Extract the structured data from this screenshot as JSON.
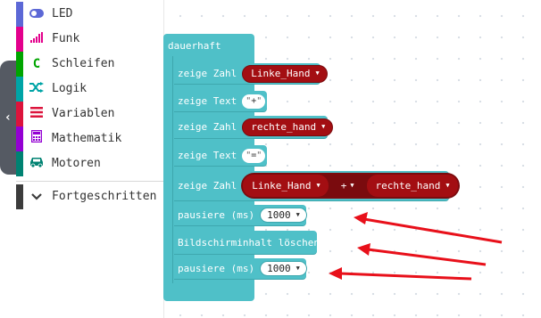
{
  "toolbox": {
    "categories": [
      {
        "label": "LED",
        "color": "#5c68d6",
        "icon": "toggle-icon"
      },
      {
        "label": "Funk",
        "color": "#e3008c",
        "icon": "signal-bars-icon"
      },
      {
        "label": "Schleifen",
        "color": "#00a500",
        "icon": "refresh-icon"
      },
      {
        "label": "Logik",
        "color": "#00a4a6",
        "icon": "shuffle-icon"
      },
      {
        "label": "Variablen",
        "color": "#dc143c",
        "icon": "list-icon"
      },
      {
        "label": "Mathematik",
        "color": "#9400d3",
        "icon": "calculator-icon"
      },
      {
        "label": "Motoren",
        "color": "#008272",
        "icon": "car-icon"
      }
    ],
    "advanced": {
      "label": "Fortgeschritten",
      "color": "#3c3c3c",
      "icon": "chevron-down-icon"
    }
  },
  "blocks": {
    "forever": "dauerhaft",
    "show_number_1": {
      "label": "zeige Zahl",
      "var": "Linke_Hand"
    },
    "show_text_1": {
      "label": "zeige Text",
      "value": "+"
    },
    "show_number_2": {
      "label": "zeige Zahl",
      "var": "rechte_hand"
    },
    "show_text_2": {
      "label": "zeige Text",
      "value": "="
    },
    "show_number_3": {
      "label": "zeige Zahl",
      "left": "Linke_Hand",
      "op": "+",
      "right": "rechte_hand"
    },
    "pause_1": {
      "label": "pausiere (ms)",
      "value": "1000"
    },
    "clear_screen": "Bildschirminhalt löschen",
    "pause_2": {
      "label": "pausiere (ms)",
      "value": "1000"
    }
  },
  "colors": {
    "block": "#4fc0c8",
    "variable": "#a30e12",
    "annotation_arrow": "#e8101a"
  }
}
